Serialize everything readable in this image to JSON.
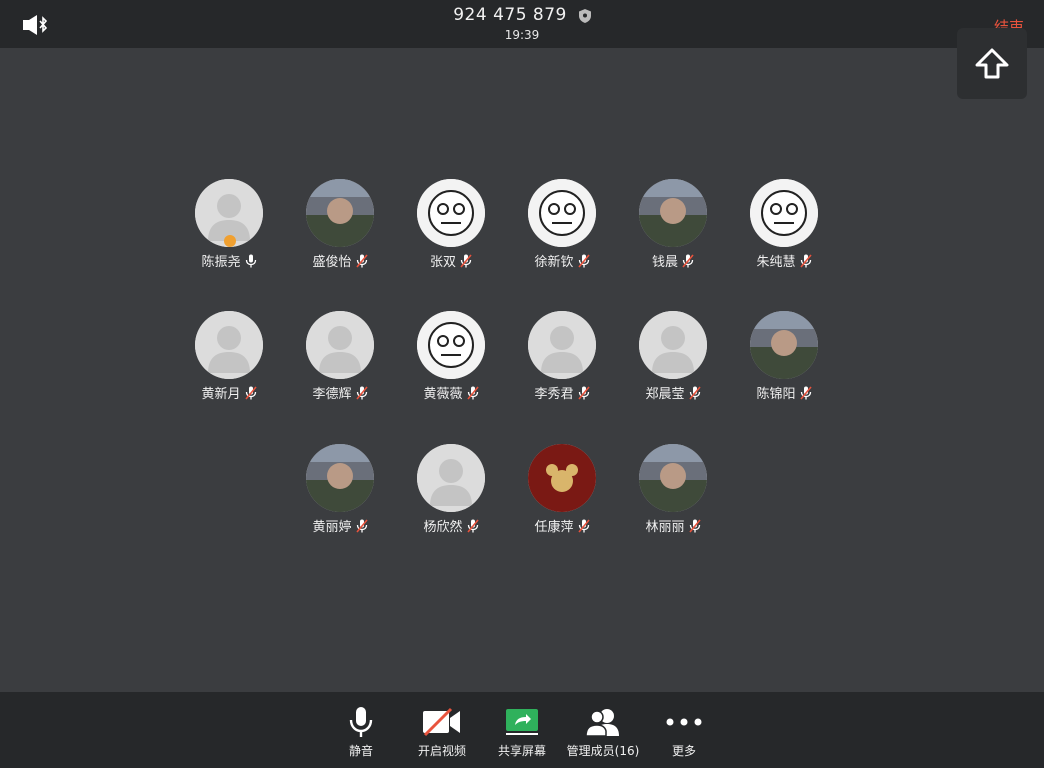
{
  "header": {
    "meeting_id": "924 475 879",
    "time": "19:39",
    "end_label": "结束"
  },
  "participants": [
    {
      "name": "陈振尧",
      "mic": "on",
      "avatar": "default-avatar",
      "host": true
    },
    {
      "name": "盛俊怡",
      "mic": "muted",
      "avatar": "photo-avatar"
    },
    {
      "name": "张双",
      "mic": "muted",
      "avatar": "cartoon-avatar"
    },
    {
      "name": "徐新钦",
      "mic": "muted",
      "avatar": "cartoon-avatar"
    },
    {
      "name": "钱晨",
      "mic": "muted",
      "avatar": "photo-avatar"
    },
    {
      "name": "朱纯慧",
      "mic": "muted",
      "avatar": "cartoon-avatar"
    },
    {
      "name": "黄新月",
      "mic": "muted",
      "avatar": "default-avatar"
    },
    {
      "name": "李德辉",
      "mic": "muted",
      "avatar": "default-avatar"
    },
    {
      "name": "黄薇薇",
      "mic": "muted",
      "avatar": "cartoon-avatar"
    },
    {
      "name": "李秀君",
      "mic": "muted",
      "avatar": "default-avatar"
    },
    {
      "name": "郑晨莹",
      "mic": "muted",
      "avatar": "default-avatar"
    },
    {
      "name": "陈锦阳",
      "mic": "muted",
      "avatar": "photo-avatar"
    },
    {
      "name": "黄丽婷",
      "mic": "muted",
      "avatar": "photo-avatar"
    },
    {
      "name": "杨欣然",
      "mic": "muted",
      "avatar": "default-avatar"
    },
    {
      "name": "任康萍",
      "mic": "muted",
      "avatar": "logo-avatar"
    },
    {
      "name": "林丽丽",
      "mic": "muted",
      "avatar": "photo-avatar"
    }
  ],
  "toolbar": {
    "mute_label": "静音",
    "video_label": "开启视频",
    "share_label": "共享屏幕",
    "members_label": "管理成员(16)",
    "more_label": "更多"
  },
  "colors": {
    "background": "#3b3d40",
    "bar": "#26282a",
    "end": "#e8533d",
    "share_green": "#2fb15c",
    "mute_red": "#e8533d"
  }
}
